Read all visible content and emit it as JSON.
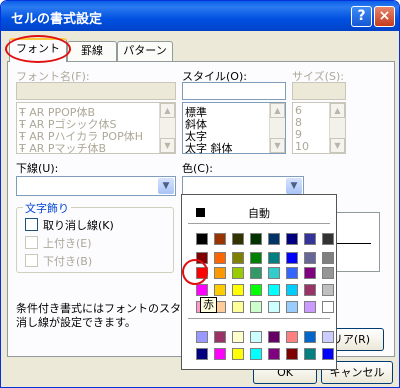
{
  "window": {
    "title": "セルの書式設定",
    "help": "?",
    "close": "×"
  },
  "tabs": [
    "フォント",
    "罫線",
    "パターン"
  ],
  "font": {
    "name_label": "フォント名(F):",
    "name_items": [
      "AR PPOP体B",
      "AR Pゴシック体S",
      "AR Pハイカラ POP体H",
      "AR Pマッチ体B"
    ],
    "style_label": "スタイル(O):",
    "style_items": [
      "標準",
      "斜体",
      "太字",
      "太字 斜体"
    ],
    "size_label": "サイズ(S):",
    "size_items": [
      "6",
      "8",
      "9",
      "10"
    ],
    "underline_label": "下線(U):",
    "color_label": "色(C):"
  },
  "effects": {
    "group_label": "文字飾り",
    "strike": "取り消し線(K)",
    "superscript": "上付き(E)",
    "subscript": "下付き(B)"
  },
  "note_lines": [
    "条件付き書式にはフォントのスタイル",
    "消し線が設定できます。"
  ],
  "buttons": {
    "clear_partial": "リア(R)",
    "ok_partial": "OK",
    "cancel": "キャンセル"
  },
  "palette": {
    "auto_label": "自動",
    "tooltip": "赤",
    "rows": [
      [
        "#000000",
        "#993300",
        "#333300",
        "#003300",
        "#003366",
        "#000080",
        "#333399",
        "#333333"
      ],
      [
        "#800000",
        "#ff6600",
        "#808000",
        "#008000",
        "#008080",
        "#0000ff",
        "#666699",
        "#808080"
      ],
      [
        "#ff0000",
        "#ff9900",
        "#99cc00",
        "#339966",
        "#33cccc",
        "#3366ff",
        "#800080",
        "#969696"
      ],
      [
        "#ff00ff",
        "#ffcc00",
        "#ffff00",
        "#00ff00",
        "#00ffff",
        "#00ccff",
        "#993366",
        "#c0c0c0"
      ],
      [
        "#ff99cc",
        "#ffcc99",
        "#ffff99",
        "#ccffcc",
        "#ccffff",
        "#99ccff",
        "#cc99ff",
        "#ffffff"
      ],
      [
        "#9999ff",
        "#993366",
        "#ffffcc",
        "#ccffff",
        "#660066",
        "#ff8080",
        "#0066cc",
        "#ccccff"
      ],
      [
        "#000080",
        "#ff00ff",
        "#ffff00",
        "#00ffff",
        "#800080",
        "#800000",
        "#008080",
        "#0000ff"
      ]
    ]
  }
}
